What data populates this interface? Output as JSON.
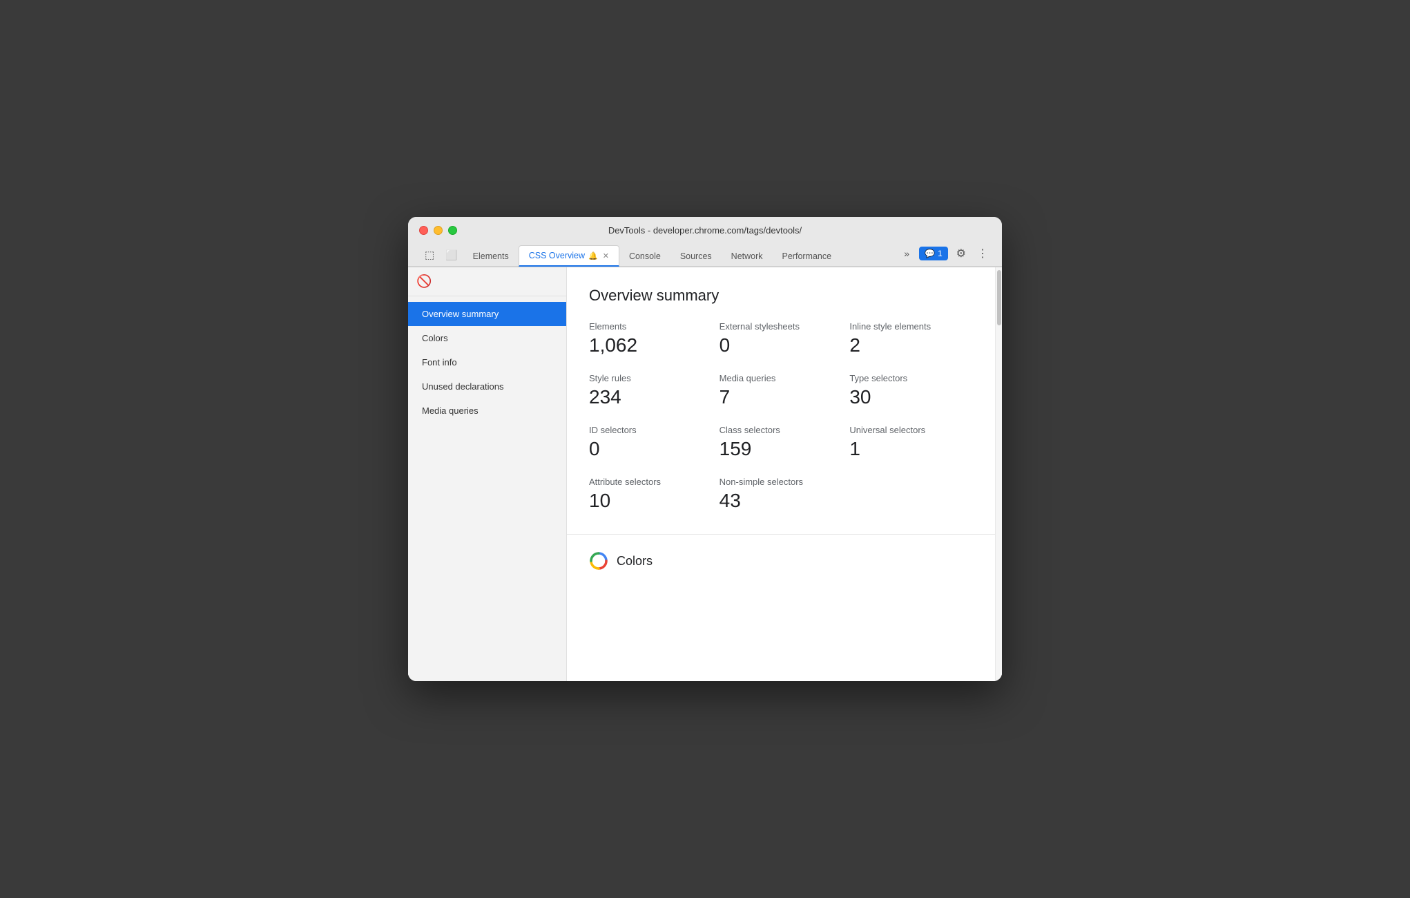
{
  "window": {
    "title": "DevTools - developer.chrome.com/tags/devtools/"
  },
  "tabs": [
    {
      "id": "elements",
      "label": "Elements",
      "active": false
    },
    {
      "id": "css-overview",
      "label": "CSS Overview",
      "active": true,
      "hasIcon": true,
      "hasClose": true
    },
    {
      "id": "console",
      "label": "Console",
      "active": false
    },
    {
      "id": "sources",
      "label": "Sources",
      "active": false
    },
    {
      "id": "network",
      "label": "Network",
      "active": false
    },
    {
      "id": "performance",
      "label": "Performance",
      "active": false
    }
  ],
  "tabs_more": "»",
  "chat_button": {
    "label": "1",
    "icon": "💬"
  },
  "sidebar": {
    "nav_items": [
      {
        "id": "overview-summary",
        "label": "Overview summary",
        "active": true
      },
      {
        "id": "colors",
        "label": "Colors",
        "active": false
      },
      {
        "id": "font-info",
        "label": "Font info",
        "active": false
      },
      {
        "id": "unused-declarations",
        "label": "Unused declarations",
        "active": false
      },
      {
        "id": "media-queries",
        "label": "Media queries",
        "active": false
      }
    ]
  },
  "main": {
    "overview_title": "Overview summary",
    "stats": [
      {
        "label": "Elements",
        "value": "1,062"
      },
      {
        "label": "External stylesheets",
        "value": "0"
      },
      {
        "label": "Inline style elements",
        "value": "2"
      },
      {
        "label": "Style rules",
        "value": "234"
      },
      {
        "label": "Media queries",
        "value": "7"
      },
      {
        "label": "Type selectors",
        "value": "30"
      },
      {
        "label": "ID selectors",
        "value": "0"
      },
      {
        "label": "Class selectors",
        "value": "159"
      },
      {
        "label": "Universal selectors",
        "value": "1"
      },
      {
        "label": "Attribute selectors",
        "value": "10"
      },
      {
        "label": "Non-simple selectors",
        "value": "43"
      }
    ],
    "colors_section_label": "Colors"
  }
}
